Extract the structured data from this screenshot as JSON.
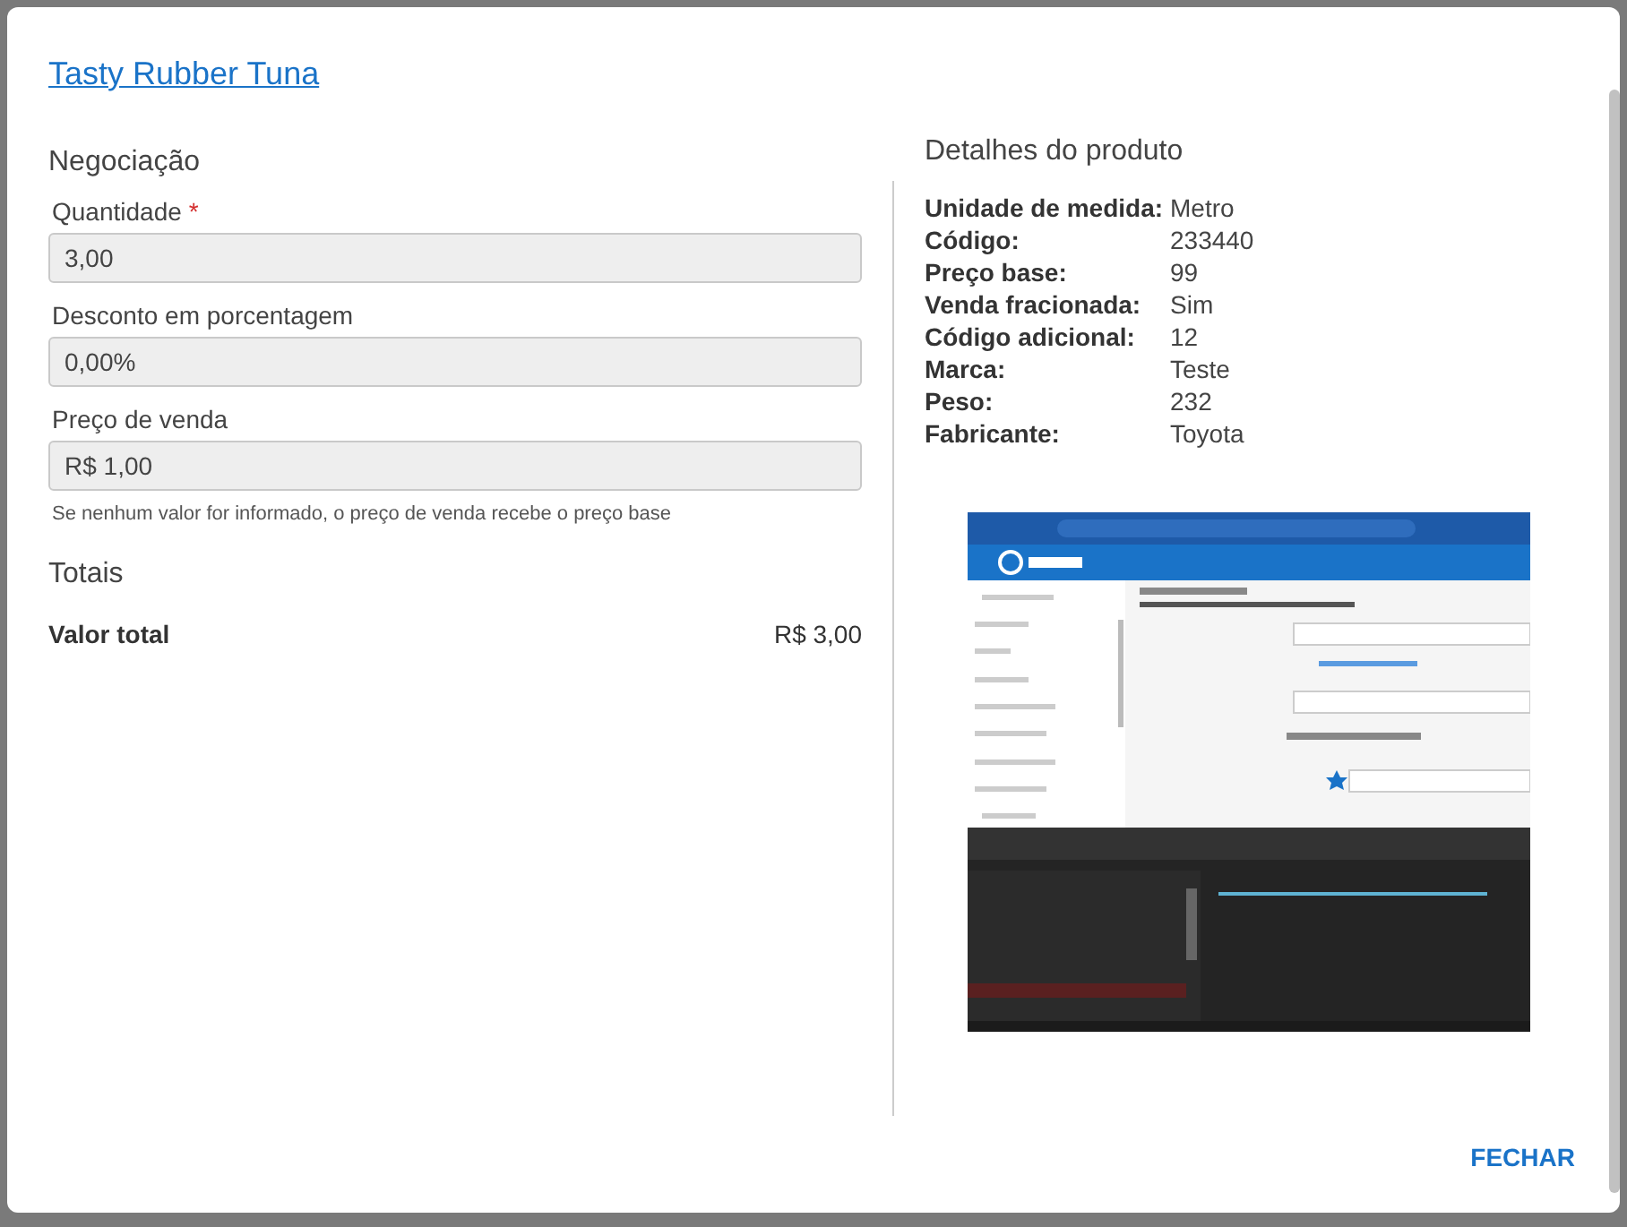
{
  "title": "Tasty Rubber Tuna",
  "required_mark": "*",
  "negotiation": {
    "heading": "Negociação",
    "fields": [
      {
        "label": "Quantidade",
        "required": true,
        "value": "3,00"
      },
      {
        "label": "Desconto em porcentagem",
        "required": false,
        "value": "0,00%"
      },
      {
        "label": "Preço de venda",
        "required": false,
        "value": "R$ 1,00",
        "help": "Se nenhum valor for informado, o preço de venda recebe o preço base"
      }
    ]
  },
  "totals": {
    "heading": "Totais",
    "rows": [
      {
        "label": "Valor total",
        "value": "R$ 3,00"
      }
    ]
  },
  "product_details": {
    "heading": "Detalhes do produto",
    "rows": [
      {
        "label": "Unidade de medida:",
        "value": "Metro"
      },
      {
        "label": "Código:",
        "value": "233440"
      },
      {
        "label": "Preço base:",
        "value": "99"
      },
      {
        "label": "Venda fracionada:",
        "value": "Sim"
      },
      {
        "label": "Código adicional:",
        "value": "12"
      },
      {
        "label": "Marca:",
        "value": "Teste"
      },
      {
        "label": "Peso:",
        "value": "232"
      },
      {
        "label": "Fabricante:",
        "value": "Toyota"
      }
    ]
  },
  "footer": {
    "buttons": [
      "FECHAR"
    ]
  }
}
